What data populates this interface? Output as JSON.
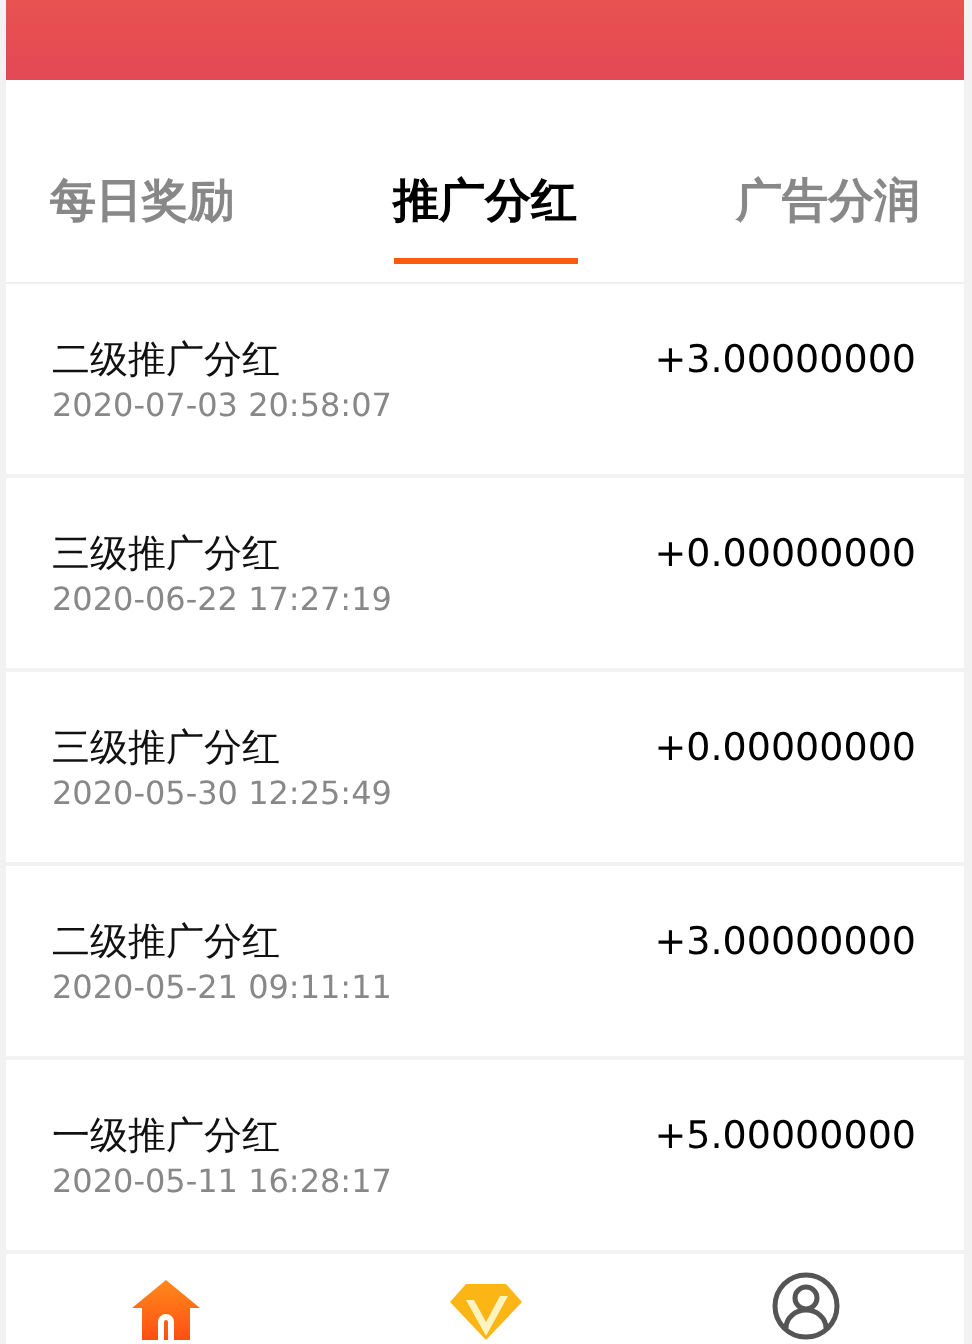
{
  "tabs": [
    {
      "label": "每日奖励",
      "selected": false
    },
    {
      "label": "推广分红",
      "selected": true
    },
    {
      "label": "广告分润",
      "selected": false
    }
  ],
  "records": [
    {
      "title": "二级推广分红",
      "time": "2020-07-03 20:58:07",
      "amount": "+3.00000000"
    },
    {
      "title": "三级推广分红",
      "time": "2020-06-22 17:27:19",
      "amount": "+0.00000000"
    },
    {
      "title": "三级推广分红",
      "time": "2020-05-30 12:25:49",
      "amount": "+0.00000000"
    },
    {
      "title": "二级推广分红",
      "time": "2020-05-21 09:11:11",
      "amount": "+3.00000000"
    },
    {
      "title": "一级推广分红",
      "time": "2020-05-11 16:28:17",
      "amount": "+5.00000000"
    }
  ],
  "nav": [
    {
      "kind": "home",
      "selected": true
    },
    {
      "kind": "vip",
      "selected": false
    },
    {
      "kind": "profile",
      "selected": false
    }
  ]
}
